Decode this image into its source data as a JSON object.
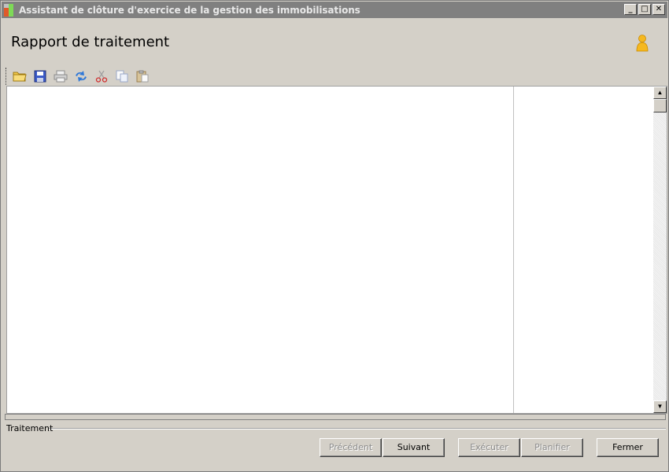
{
  "window": {
    "title": "Assistant de clôture d'exercice de la gestion des immobilisations",
    "controls": {
      "minimize": "_",
      "maximize": "□",
      "close": "✕"
    }
  },
  "header": {
    "title": "Rapport de traitement",
    "icon": "person-icon"
  },
  "toolbar": {
    "items": [
      {
        "name": "open",
        "icon": "folder-icon"
      },
      {
        "name": "save",
        "icon": "floppy-disk-icon"
      },
      {
        "name": "print",
        "icon": "printer-icon",
        "disabled": true
      },
      {
        "name": "refresh",
        "icon": "refresh-icon"
      },
      {
        "name": "cut",
        "icon": "scissors-icon",
        "disabled": true
      },
      {
        "name": "copy",
        "icon": "copy-icon",
        "disabled": true
      },
      {
        "name": "paste",
        "icon": "paste-icon",
        "disabled": true
      }
    ]
  },
  "scrollbar": {
    "up": "▲",
    "down": "▼"
  },
  "group": {
    "label": "Traitement"
  },
  "buttons": {
    "previous": "Précédent",
    "next": "Suivant",
    "execute": "Exécuter",
    "schedule": "Planifier",
    "close": "Fermer"
  },
  "colors": {
    "face": "#d4d0c8",
    "titlebar": "#808080",
    "disabled_text": "#8c8c8c"
  }
}
